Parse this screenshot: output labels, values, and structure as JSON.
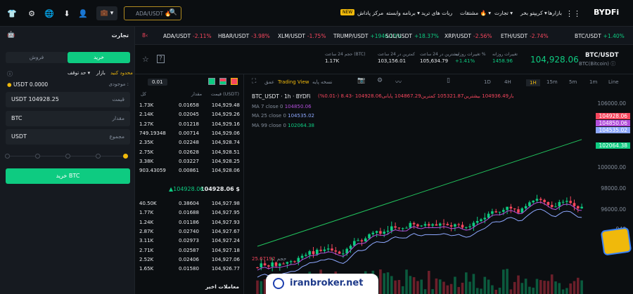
{
  "topbar": {
    "brand": "BYDFi",
    "nav": [
      "بازارها",
      "کریپتو بخر ▾",
      "تجارت ▾",
      "مشتقات 🔥 ▾",
      "ربات های ترید",
      "برنامه وابسته ▾",
      "مرکز پاداش"
    ],
    "new_badge": "NEW",
    "search_placeholder": "ADA/USDT 🔥"
  },
  "tickers": [
    {
      "name": "ADA/USDT",
      "change": "-2.11%",
      "dir": "down"
    },
    {
      "name": "HBAR/USDT",
      "change": "-3.98%",
      "dir": "down"
    },
    {
      "name": "XLM/USDT",
      "change": "-1.75%",
      "dir": "down"
    },
    {
      "name": "TRUMP/USDT",
      "change": "+1946.10%",
      "dir": "up"
    },
    {
      "name": "SOL/USDT",
      "change": "+18.37%",
      "dir": "up"
    },
    {
      "name": "XRP/USDT",
      "change": "-2.56%",
      "dir": "down"
    },
    {
      "name": "ETH/USDT",
      "change": "-2.74%",
      "dir": "down"
    },
    {
      "name": "BTC/USDT",
      "change": "+1.40%",
      "dir": "up"
    }
  ],
  "pair": {
    "symbol": "BTC/USDT",
    "sub": "BTC(Bitcoin) ⓘ",
    "price": "104,928.06",
    "stats": [
      {
        "label": "تغییرات روزانه",
        "value": "1458.96"
      },
      {
        "label": "تغییرات روزانه %",
        "value": "+1.41%"
      },
      {
        "label": "بیشترین در 24 ساعت",
        "value": "105,634.79"
      },
      {
        "label": "کمترین در 24 ساعت",
        "value": "103,156.01"
      },
      {
        "label": "حجم 24 ساعت (BTC)",
        "value": "1.17K"
      }
    ]
  },
  "left": {
    "title": "تجارت",
    "sell_tab": "فروش",
    "buy_tab": "خرید",
    "order_types": [
      "محدود کنید",
      "بازار",
      "حد توقف ▾"
    ],
    "balance_label": "موجودی :",
    "balance": "USDT 0.0000",
    "price_label": "قیمت",
    "price_value": "USDT  104928.25",
    "amount_label": "مقدار",
    "amount_value": "BTC",
    "total_label": "مجموع",
    "total_value": "USDT",
    "buy_button": "خرید BTC"
  },
  "book": {
    "precision": "0.01",
    "headers": [
      "کل",
      "مقدار",
      "قیمت (USDT)"
    ],
    "asks": [
      {
        "total": "1.73K",
        "amount": "0.01658",
        "price": "104,929.48"
      },
      {
        "total": "2.14K",
        "amount": "0.02045",
        "price": "104,929.26"
      },
      {
        "total": "1.27K",
        "amount": "0.01218",
        "price": "104,929.16"
      },
      {
        "total": "749.19348",
        "amount": "0.00714",
        "price": "104,929.06"
      },
      {
        "total": "2.35K",
        "amount": "0.02248",
        "price": "104,928.74"
      },
      {
        "total": "2.75K",
        "amount": "0.02628",
        "price": "104,928.51"
      },
      {
        "total": "3.38K",
        "amount": "0.03227",
        "price": "104,928.25"
      },
      {
        "total": "903.43059",
        "amount": "0.00861",
        "price": "104,928.06"
      }
    ],
    "last_price": "104928.06 $",
    "last_change": "▲104928.06",
    "bids": [
      {
        "total": "40.50K",
        "amount": "0.38604",
        "price": "104,927.98"
      },
      {
        "total": "1.77K",
        "amount": "0.01688",
        "price": "104,927.95"
      },
      {
        "total": "1.24K",
        "amount": "0.01186",
        "price": "104,927.93"
      },
      {
        "total": "2.87K",
        "amount": "0.02740",
        "price": "104,927.67"
      },
      {
        "total": "3.11K",
        "amount": "0.02973",
        "price": "104,927.24"
      },
      {
        "total": "2.71K",
        "amount": "0.02587",
        "price": "104,927.18"
      },
      {
        "total": "2.52K",
        "amount": "0.02406",
        "price": "104,927.06"
      },
      {
        "total": "1.65K",
        "amount": "0.01580",
        "price": "104,926.77"
      }
    ],
    "recent_trades": "معاملات اخیر"
  },
  "chart": {
    "toolbar": [
      "Line",
      "1m",
      "5m",
      "15m",
      "1H",
      "4H",
      "1D"
    ],
    "tradingview": "Trading View",
    "simple": "نسخه پایه",
    "depth": "عمق",
    "title": "BTC_USDT · 1h · BYDFi",
    "ohlc": "باز104936.49 بیشترین105321.87 کمترین104867.29 پایانی104928.06 -8.43 (-0.01%)",
    "ma7": "MA  7 close 0",
    "ma7_val": "104850.06",
    "ma25": "MA  25 close 0",
    "ma25_val": "104535.02",
    "ma99": "MA  99 close 0",
    "ma99_val": "102064.38",
    "volume_label": "حجم",
    "volume_val": "25.67192",
    "y_labels": [
      "106000.00",
      "102000.00",
      "100000.00",
      "98000.00",
      "96000.00",
      "940"
    ],
    "price_tags": [
      "104928.06",
      "104850.06",
      "104535.02",
      "102064.38"
    ],
    "colors": {
      "up": "#0ecb81",
      "down": "#f6465d",
      "ma7": "#b34edb",
      "ma25": "#8ea8ff",
      "ma99": "#22c55e"
    }
  },
  "watermark": "iranbroker.net"
}
